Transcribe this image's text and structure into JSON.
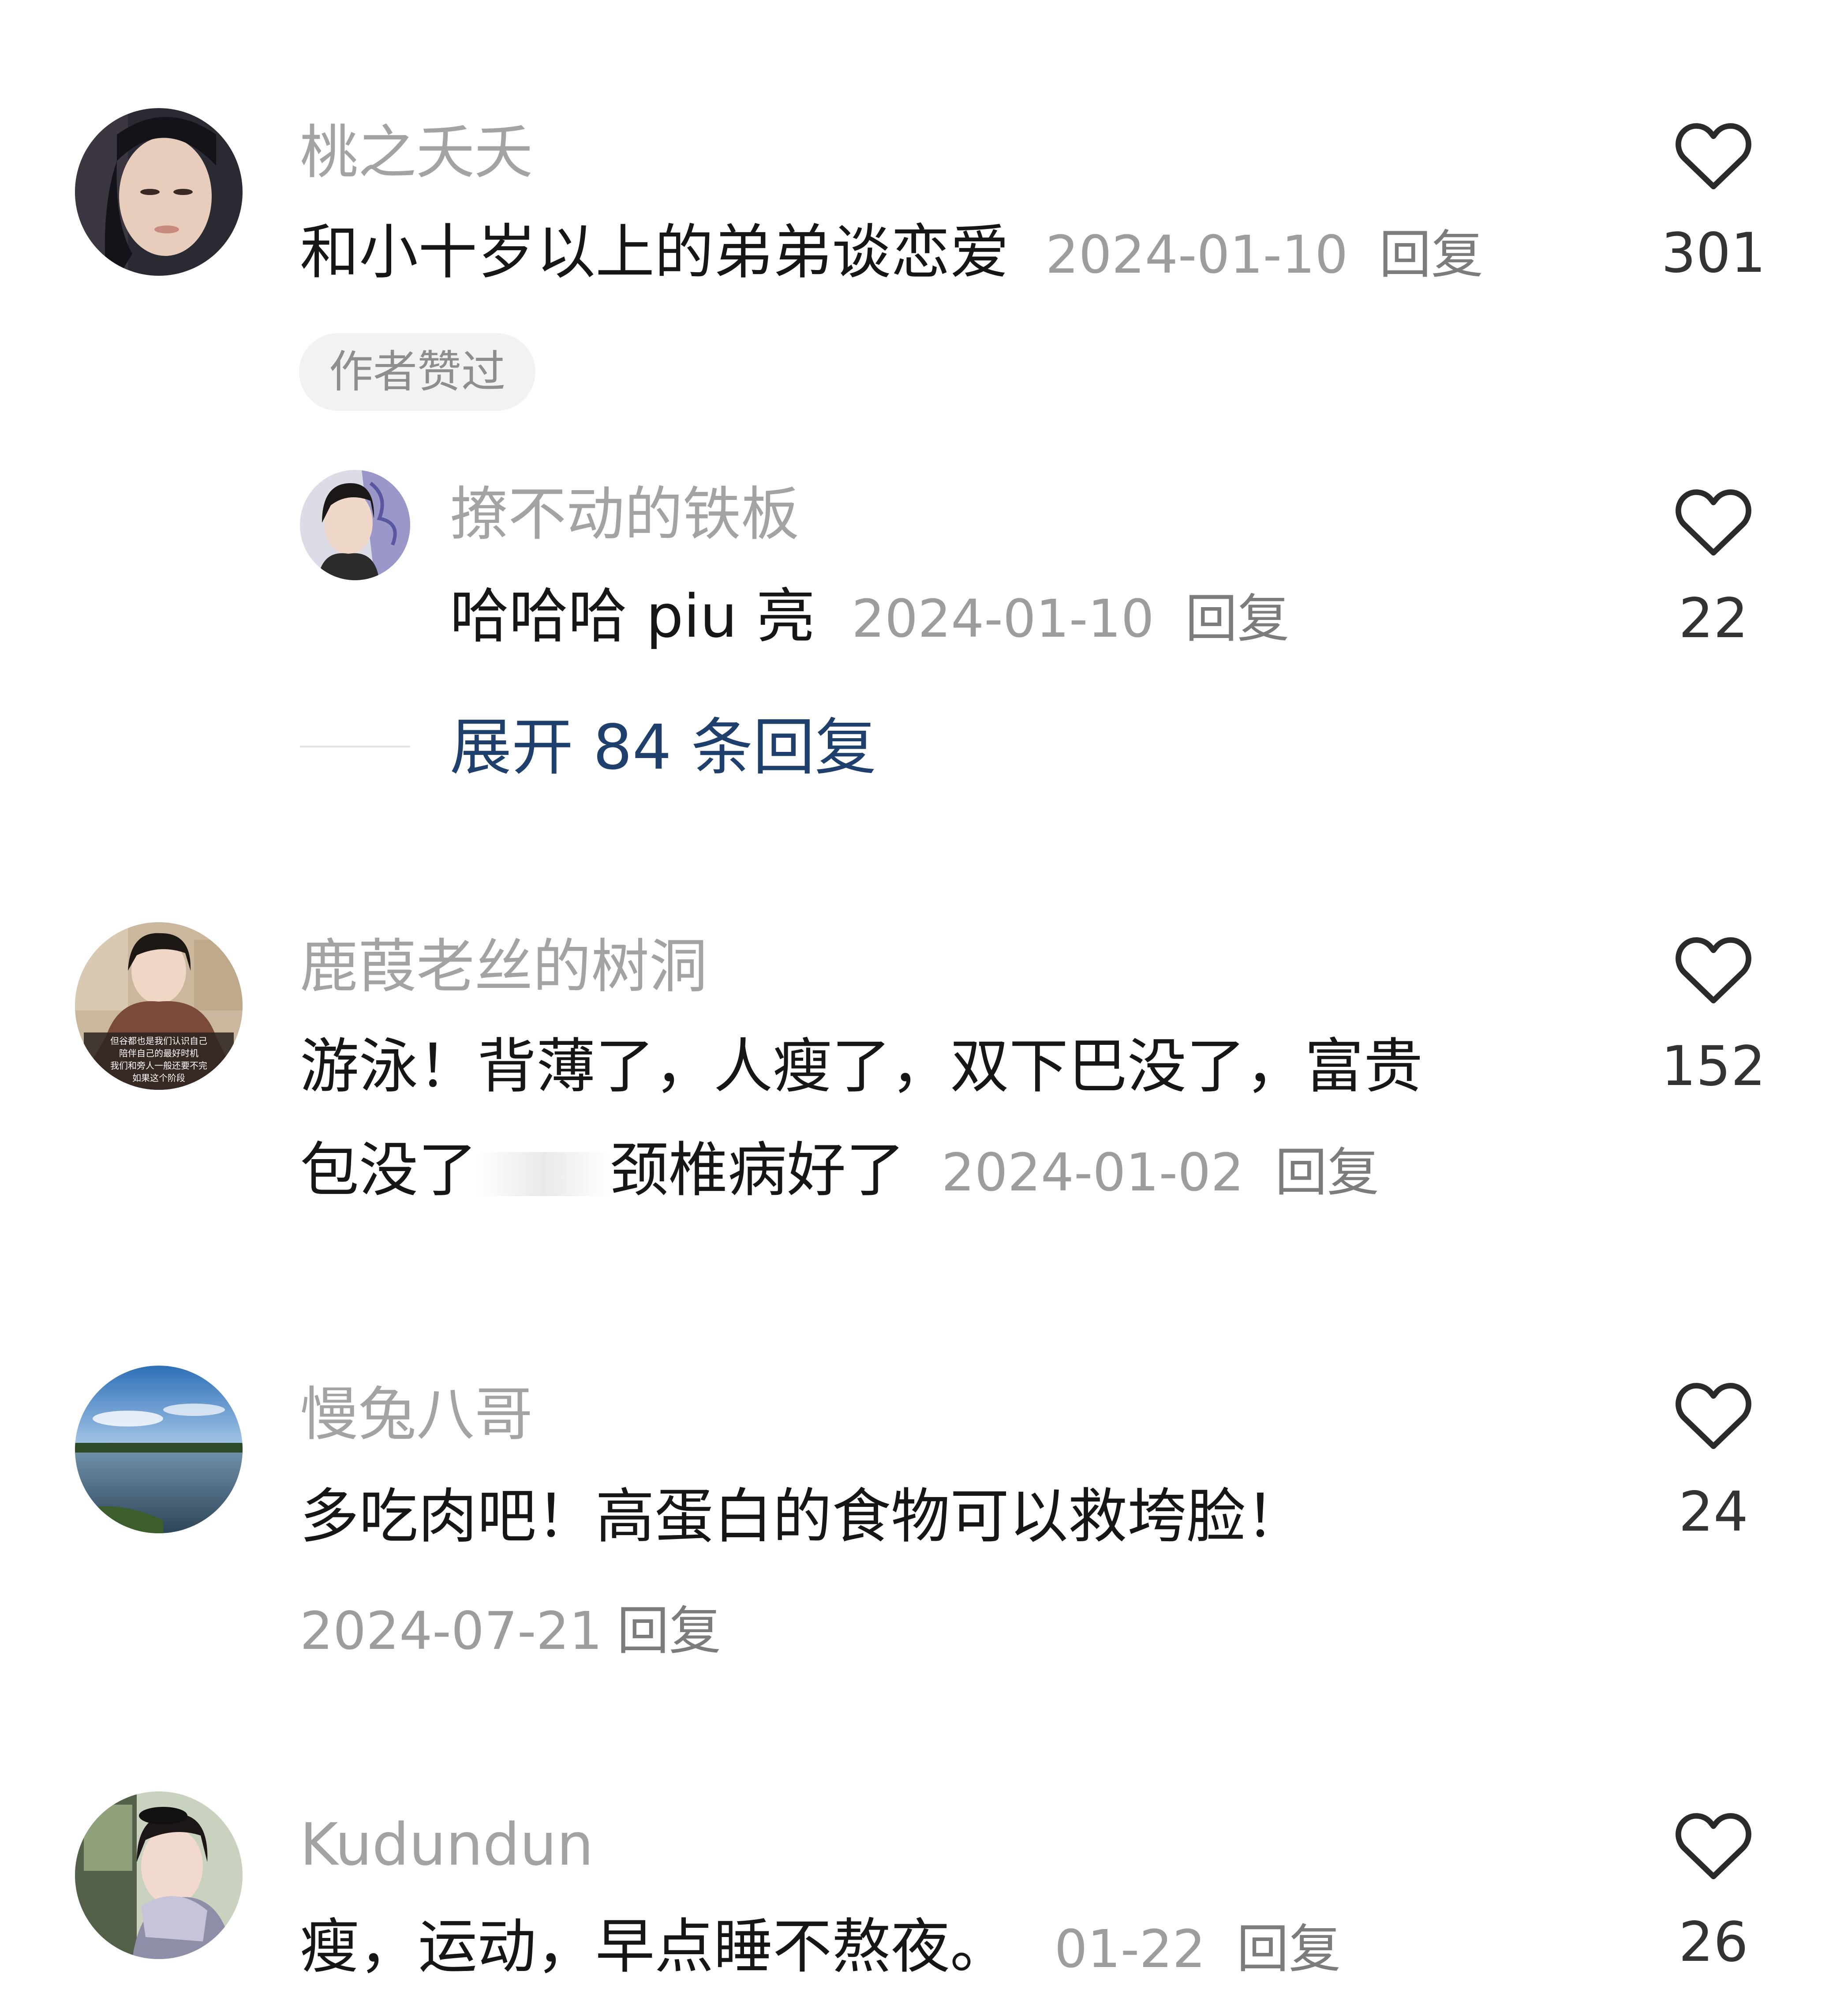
{
  "comments": [
    {
      "username": "桃之夭夭",
      "text": "和小十岁以上的弟弟谈恋爱",
      "date": "2024-01-10",
      "reply_label": "回复",
      "likes": "301",
      "badge": "作者赞过",
      "sub_reply": {
        "username": "撩不动的铁板",
        "text": "哈哈哈 piu 亮",
        "date": "2024-01-10",
        "reply_label": "回复",
        "likes": "22"
      },
      "expand_label": "展开 84 条回复"
    },
    {
      "username": "鹿葭老丝的树洞",
      "text_line1": "游泳！背薄了，人瘦了，双下巴没了，富贵",
      "text_line2_a": "包没了",
      "text_line2_b": "颈椎病好了",
      "date": "2024-01-02",
      "reply_label": "回复",
      "likes": "152",
      "avatar_caption_lines": [
        "但谷都也是我们认识自己",
        "陪伴自己的最好时机",
        "我们和旁人一般还要不完",
        "如果这个阶段"
      ]
    },
    {
      "username": "慢兔八哥",
      "text": "多吃肉吧！高蛋白的食物可以救垮脸！",
      "date": "2024-07-21",
      "reply_label": "回复",
      "likes": "24"
    },
    {
      "username": "Kudundun",
      "text": "瘦，运动，早点睡不熬夜。",
      "date": "01-22",
      "reply_label": "回复",
      "likes": "26"
    }
  ],
  "colors": {
    "username": "#a3a3a3",
    "text": "#161616",
    "meta": "#9d9d9d",
    "expand_link": "#1f3f6d",
    "badge_bg": "#f2f2f2"
  },
  "icons": {
    "like": "heart-outline-icon"
  }
}
